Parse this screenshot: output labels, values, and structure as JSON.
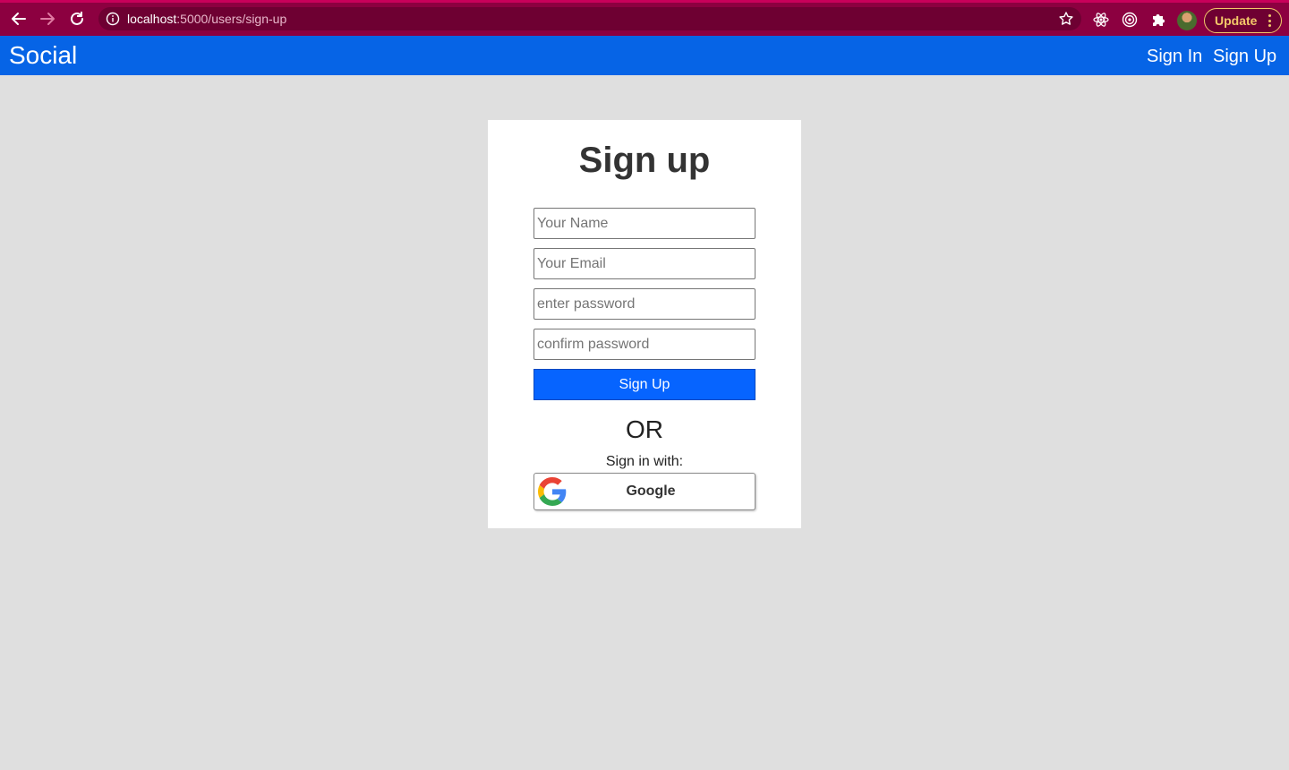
{
  "browser": {
    "url_host": "localhost",
    "url_path": ":5000/users/sign-up",
    "update_label": "Update",
    "icons": [
      "back-arrow-icon",
      "forward-arrow-icon",
      "reload-icon",
      "info-icon",
      "star-icon",
      "react-extension-icon",
      "target-extension-icon",
      "puzzle-extension-icon",
      "profile-avatar",
      "kebab-menu-icon"
    ],
    "theme_color": "#8c0040"
  },
  "navbar": {
    "brand": "Social",
    "links": [
      "Sign In",
      "Sign Up"
    ],
    "color": "#0664e6"
  },
  "form": {
    "title": "Sign up",
    "name_placeholder": "Your Name",
    "email_placeholder": "Your Email",
    "password_placeholder": "enter password",
    "confirm_placeholder": "confirm password",
    "submit_label": "Sign Up",
    "or_text": "OR",
    "signin_with": "Sign in with:",
    "google_label": "Google",
    "button_color": "#0664ff"
  }
}
